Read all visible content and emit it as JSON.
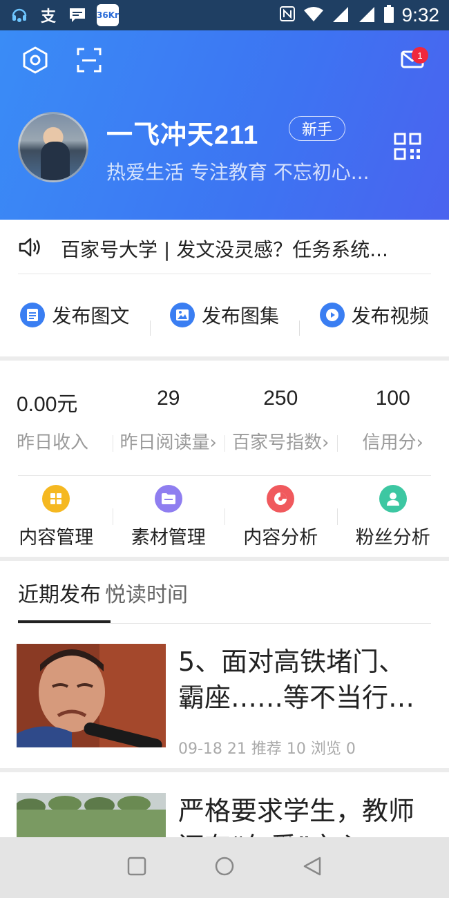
{
  "status_bar": {
    "time": "9:32",
    "left_icons": [
      "headset-icon",
      "alipay-icon",
      "message-icon",
      "36kr-icon"
    ],
    "kr_label": "36Kr",
    "alipay_glyph": "支",
    "right_icons": [
      "nfc-icon",
      "wifi-icon",
      "signal-icon",
      "signal-icon",
      "battery-icon"
    ]
  },
  "header": {
    "mail_badge": "1",
    "username": "一飞冲天211",
    "level": "新手",
    "bio": "热爱生活 专注教育 不忘初心..."
  },
  "notice": {
    "text": "百家号大学 | 发文没灵感？任务系统..."
  },
  "publish": [
    {
      "label": "发布图文",
      "icon": "article-icon"
    },
    {
      "label": "发布图集",
      "icon": "image-icon"
    },
    {
      "label": "发布视频",
      "icon": "play-icon"
    }
  ],
  "stats": [
    {
      "value": "0.00元",
      "label": "昨日收入"
    },
    {
      "value": "29",
      "label": "昨日阅读量›"
    },
    {
      "value": "250",
      "label": "百家号指数›"
    },
    {
      "value": "100",
      "label": "信用分›"
    }
  ],
  "tools": [
    {
      "label": "内容管理",
      "icon": "grid-icon",
      "color": "#f5b821"
    },
    {
      "label": "素材管理",
      "icon": "folder-icon",
      "color": "#8f7ef0"
    },
    {
      "label": "内容分析",
      "icon": "pie-chart-icon",
      "color": "#f0595d"
    },
    {
      "label": "粉丝分析",
      "icon": "user-icon",
      "color": "#3dc7a2"
    }
  ],
  "tabs": {
    "active": "近期发布",
    "other": "悦读时间"
  },
  "articles": [
    {
      "title": "5、面对高铁堵门、霸座……等不当行…",
      "meta": "09-18 21   推荐 10   浏览 0"
    },
    {
      "title": "严格要求学生，教师还有“仁爱”之心"
    }
  ],
  "colors": {
    "header_gradient_start": "#3a8cf6",
    "header_gradient_end": "#4a63ef",
    "accent_blue": "#3a7ef2",
    "badge_red": "#f0283c"
  }
}
